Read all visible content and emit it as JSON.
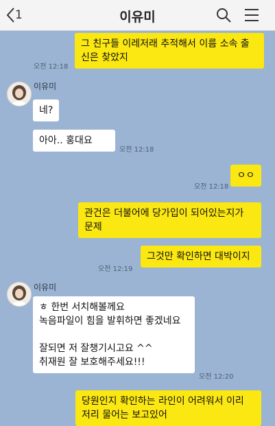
{
  "header": {
    "back_count": "1",
    "title": "이유미",
    "search_icon": "search-icon",
    "menu_icon": "menu-icon"
  },
  "messages": [
    {
      "type": "sent",
      "text": "그 친구들 이레저래 추적해서 이름 소속 출\n신은 찾았지",
      "time": "오전 12:18"
    },
    {
      "type": "received",
      "sender": "이유미",
      "text": "네?"
    },
    {
      "type": "received",
      "text": "아아.. 홍대요",
      "time": "오전 12:18"
    },
    {
      "type": "sent",
      "text": "ㅇㅇ",
      "time": "오전 12:18"
    },
    {
      "type": "sent",
      "text": "관건은 더불어에 당가입이 되어있는지가\n문제"
    },
    {
      "type": "sent",
      "text": "그것만 확인하면 대박이지",
      "time": "오전 12:19"
    },
    {
      "type": "received",
      "sender": "이유미",
      "text": "ㅎ 한번 서치해볼께요\n녹음파일이 힘을 발휘하면 좋겠네요\n\n잘되면 저 잘챙기시고요 ^^\n취재원 잘 보호해주세요!!!",
      "time": "오전 12:20"
    },
    {
      "type": "sent",
      "text": "당원인지 확인하는 라인이 어려워서 이리\n저리 물어는 보고있어"
    }
  ],
  "colors": {
    "background": "#9bb4d3",
    "sent_bubble": "#fbe711",
    "received_bubble": "#ffffff",
    "header": "#f4f4f4"
  }
}
